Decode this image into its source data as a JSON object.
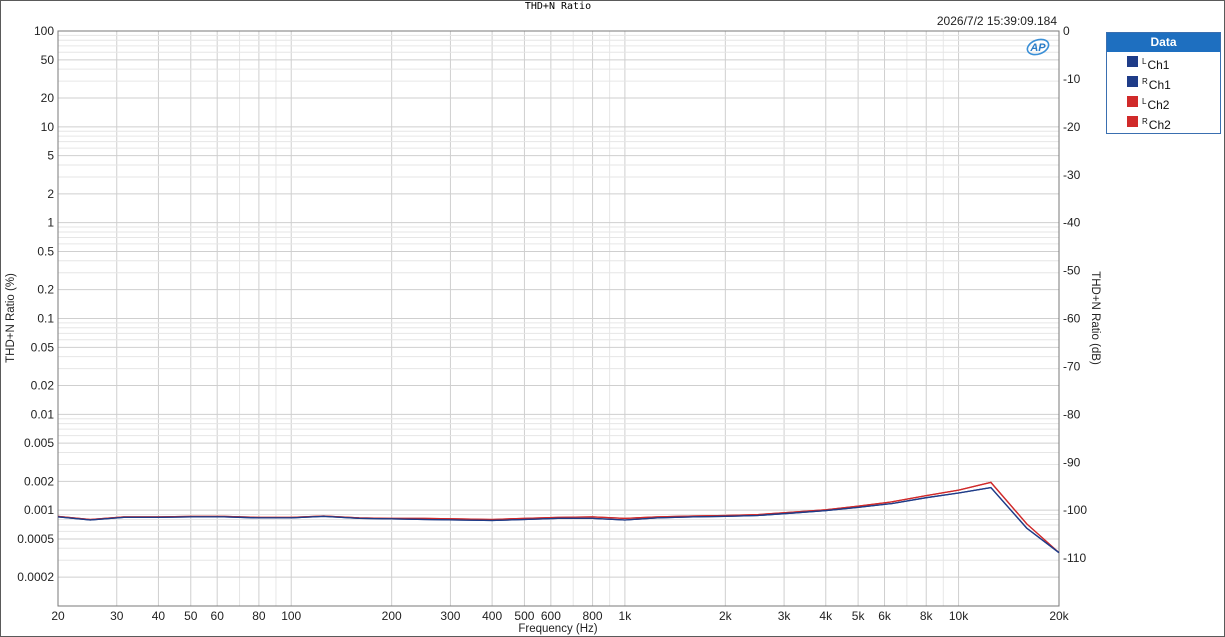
{
  "chart_data": {
    "type": "line",
    "title": "THD+N Ratio",
    "timestamp": "2026/7/2 15:39:09.184",
    "logo": "AP",
    "xlabel": "Frequency (Hz)",
    "ylabel_left": "THD+N Ratio (%)",
    "ylabel_right": "THD+N Ratio (dB)",
    "x_scale": "log",
    "y_scale": "log",
    "xlim": [
      20,
      20000
    ],
    "ylim_left": [
      0.0001,
      100
    ],
    "ylim_right": [
      -120,
      0
    ],
    "grid": true,
    "x_ticks": [
      20,
      30,
      40,
      50,
      60,
      80,
      100,
      200,
      300,
      400,
      500,
      600,
      800,
      1000,
      2000,
      3000,
      4000,
      5000,
      6000,
      8000,
      10000,
      20000
    ],
    "x_tick_labels": [
      "20",
      "30",
      "40",
      "50",
      "60",
      "80",
      "100",
      "200",
      "300",
      "400",
      "500",
      "600",
      "800",
      "1k",
      "2k",
      "3k",
      "4k",
      "5k",
      "6k",
      "8k",
      "10k",
      "20k"
    ],
    "y_left_ticks": [
      100,
      50,
      20,
      10,
      5,
      2,
      1,
      0.5,
      0.2,
      0.1,
      0.05,
      0.02,
      0.01,
      0.005,
      0.002,
      0.001,
      0.0005,
      0.0002
    ],
    "y_left_tick_labels": [
      "100",
      "50",
      "20",
      "10",
      "5",
      "2",
      "1",
      "0.5",
      "0.2",
      "0.1",
      "0.05",
      "0.02",
      "0.01",
      "0.005",
      "0.002",
      "0.001",
      "0.0005",
      "0.0002"
    ],
    "y_right_ticks": [
      0,
      -10,
      -20,
      -30,
      -40,
      -50,
      -60,
      -70,
      -80,
      -90,
      -100,
      -110
    ],
    "y_right_tick_labels": [
      "0",
      "-10",
      "-20",
      "-30",
      "-40",
      "-50",
      "-60",
      "-70",
      "-80",
      "-90",
      "-100",
      "-110"
    ],
    "legend": {
      "title": "Data",
      "position": "top-right"
    },
    "x": [
      20,
      25,
      31.5,
      40,
      50,
      63,
      80,
      100,
      125,
      160,
      200,
      250,
      315,
      400,
      500,
      630,
      800,
      1000,
      1250,
      1600,
      2000,
      2500,
      3150,
      4000,
      5000,
      6300,
      8000,
      10000,
      12500,
      16000,
      20000
    ],
    "series": [
      {
        "name": "Ch1",
        "channel": "L",
        "color": "#1f3c88",
        "values": [
          0.00085,
          0.00079,
          0.00084,
          0.00084,
          0.00085,
          0.00085,
          0.00083,
          0.00083,
          0.00086,
          0.00082,
          0.00081,
          0.0008,
          0.00079,
          0.00078,
          0.0008,
          0.00082,
          0.00082,
          0.00079,
          0.00083,
          0.00085,
          0.00086,
          0.00088,
          0.00093,
          0.00099,
          0.00107,
          0.00117,
          0.00135,
          0.00151,
          0.00172,
          0.00065,
          0.00036
        ]
      },
      {
        "name": "Ch1",
        "channel": "R",
        "color": "#1f3c88",
        "values": [
          0.00085,
          0.00079,
          0.00084,
          0.00084,
          0.00085,
          0.00085,
          0.00083,
          0.00083,
          0.00086,
          0.00082,
          0.00081,
          0.0008,
          0.00079,
          0.00078,
          0.0008,
          0.00082,
          0.00082,
          0.00079,
          0.00083,
          0.00085,
          0.00086,
          0.00088,
          0.00093,
          0.00099,
          0.00107,
          0.00117,
          0.00135,
          0.00151,
          0.00172,
          0.00065,
          0.00036
        ]
      },
      {
        "name": "Ch2",
        "channel": "L",
        "color": "#d02a2a",
        "values": [
          0.00086,
          0.0008,
          0.00085,
          0.00085,
          0.00086,
          0.00086,
          0.00084,
          0.00084,
          0.00087,
          0.00083,
          0.00082,
          0.00082,
          0.00081,
          0.0008,
          0.00082,
          0.00084,
          0.00085,
          0.00082,
          0.00085,
          0.00087,
          0.00088,
          0.0009,
          0.00095,
          0.00101,
          0.0011,
          0.00122,
          0.00142,
          0.00162,
          0.00195,
          0.00072,
          0.00036
        ]
      },
      {
        "name": "Ch2",
        "channel": "R",
        "color": "#d02a2a",
        "values": [
          0.00086,
          0.0008,
          0.00085,
          0.00085,
          0.00086,
          0.00086,
          0.00084,
          0.00084,
          0.00087,
          0.00083,
          0.00082,
          0.00082,
          0.00081,
          0.0008,
          0.00082,
          0.00084,
          0.00085,
          0.00082,
          0.00085,
          0.00087,
          0.00088,
          0.0009,
          0.00095,
          0.00101,
          0.0011,
          0.00122,
          0.00142,
          0.00162,
          0.00195,
          0.00072,
          0.00036
        ]
      }
    ]
  }
}
